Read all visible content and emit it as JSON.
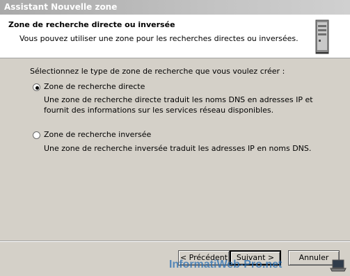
{
  "window": {
    "title": "Assistant Nouvelle zone"
  },
  "header": {
    "title": "Zone de recherche directe ou inversée",
    "subtitle": "Vous pouvez utiliser une zone pour les recherches directes ou inversées."
  },
  "main": {
    "prompt": "Sélectionnez le type de zone de recherche que vous voulez créer :",
    "options": [
      {
        "label": "Zone de recherche directe",
        "selected": true,
        "description": "Une zone de recherche directe traduit les noms DNS en adresses IP et fournit des informations sur les services réseau disponibles."
      },
      {
        "label": "Zone de recherche inversée",
        "selected": false,
        "description": "Une zone de recherche inversée traduit les adresses IP en noms DNS."
      }
    ]
  },
  "buttons": {
    "back": "< Précédent",
    "next": "Suivant >",
    "cancel": "Annuler"
  },
  "watermark": {
    "text": "InformatiWeb-Pro.net"
  },
  "icons": {
    "header": "server-icon",
    "watermark": "laptop-icon"
  }
}
